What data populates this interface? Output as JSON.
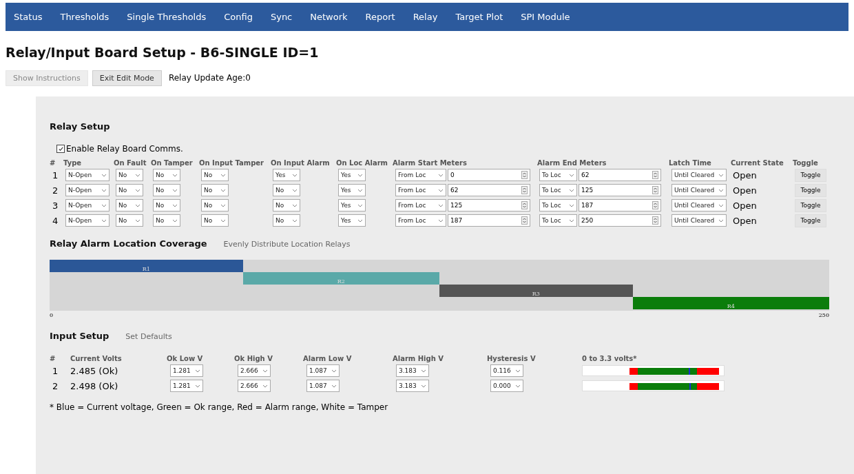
{
  "nav": [
    "Status",
    "Thresholds",
    "Single Thresholds",
    "Config",
    "Sync",
    "Network",
    "Report",
    "Relay",
    "Target Plot",
    "SPI Module"
  ],
  "title": "Relay/Input Board Setup - B6-SINGLE ID=1",
  "buttons": [
    {
      "label": "Show Instructions",
      "disabled": true
    },
    {
      "label": "Exit Edit Mode",
      "disabled": false
    }
  ],
  "update_age": "Relay Update Age:0",
  "relay_setup": {
    "heading": "Relay Setup",
    "enable_label": "Enable Relay Board Comms.",
    "enable_checked": true,
    "columns": [
      "#",
      "Type",
      "On Fault",
      "On Tamper",
      "On Input Tamper",
      "On Input Alarm",
      "On Loc Alarm",
      "Alarm Start Meters",
      "Alarm End Meters",
      "Latch Time",
      "Current State",
      "Toggle"
    ],
    "rows": [
      {
        "num": "1",
        "type": "N-Open",
        "on_fault": "No",
        "on_tamper": "No",
        "on_input_tamper": "No",
        "on_input_alarm": "Yes",
        "on_loc_alarm": "Yes",
        "start_mode": "From Loc",
        "start": "0",
        "end_mode": "To Loc",
        "end": "62",
        "latch": "Until Cleared",
        "state": "Open",
        "toggle": "Toggle"
      },
      {
        "num": "2",
        "type": "N-Open",
        "on_fault": "No",
        "on_tamper": "No",
        "on_input_tamper": "No",
        "on_input_alarm": "No",
        "on_loc_alarm": "Yes",
        "start_mode": "From Loc",
        "start": "62",
        "end_mode": "To Loc",
        "end": "125",
        "latch": "Until Cleared",
        "state": "Open",
        "toggle": "Toggle"
      },
      {
        "num": "3",
        "type": "N-Open",
        "on_fault": "No",
        "on_tamper": "No",
        "on_input_tamper": "No",
        "on_input_alarm": "No",
        "on_loc_alarm": "Yes",
        "start_mode": "From Loc",
        "start": "125",
        "end_mode": "To Loc",
        "end": "187",
        "latch": "Until Cleared",
        "state": "Open",
        "toggle": "Toggle"
      },
      {
        "num": "4",
        "type": "N-Open",
        "on_fault": "No",
        "on_tamper": "No",
        "on_input_tamper": "No",
        "on_input_alarm": "No",
        "on_loc_alarm": "Yes",
        "start_mode": "From Loc",
        "start": "187",
        "end_mode": "To Loc",
        "end": "250",
        "latch": "Until Cleared",
        "state": "Open",
        "toggle": "Toggle"
      }
    ]
  },
  "coverage": {
    "heading": "Relay Alarm Location Coverage",
    "action": "Evenly Distribute Location Relays",
    "axis_min": "0",
    "axis_max": "250",
    "bars": [
      {
        "label": "R1",
        "color": "#2b5797"
      },
      {
        "label": "R2",
        "color": "#5aa9a8"
      },
      {
        "label": "R3",
        "color": "#555555"
      },
      {
        "label": "R4",
        "color": "#0b7d0b"
      }
    ]
  },
  "input_setup": {
    "heading": "Input Setup",
    "action": "Set Defaults",
    "columns": [
      "#",
      "Current Volts",
      "Ok Low V",
      "Ok High V",
      "Alarm Low V",
      "Alarm High V",
      "Hysteresis V",
      "0 to 3.3 volts*"
    ],
    "rows": [
      {
        "num": "1",
        "current": "2.485 (Ok)",
        "ok_low": "1.281",
        "ok_high": "2.666",
        "alarm_low": "1.087",
        "alarm_high": "3.183",
        "hysteresis": "0.116"
      },
      {
        "num": "2",
        "current": "2.498 (Ok)",
        "ok_low": "1.281",
        "ok_high": "2.666",
        "alarm_low": "1.087",
        "alarm_high": "3.183",
        "hysteresis": "0.000"
      }
    ],
    "legend": "* Blue = Current voltage, Green = Ok range, Red = Alarm range, White = Tamper"
  }
}
